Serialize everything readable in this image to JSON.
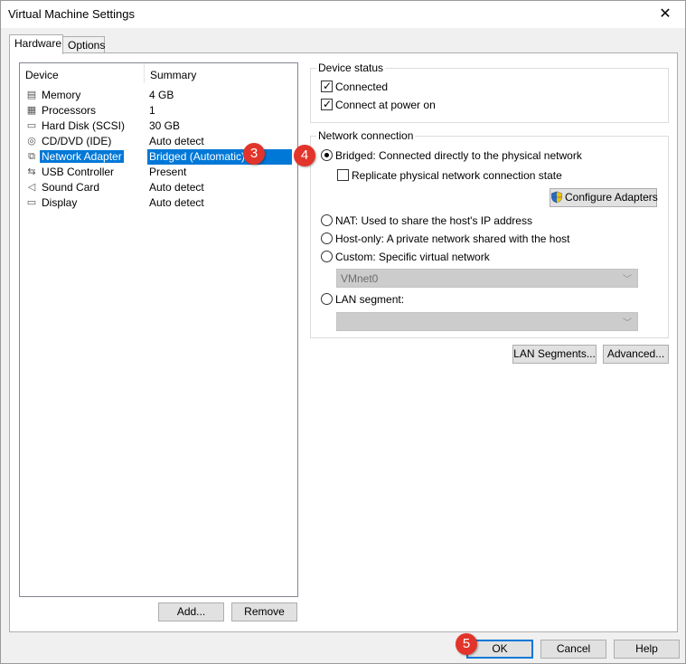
{
  "window": {
    "title": "Virtual Machine Settings",
    "close_glyph": "✕"
  },
  "tabs": [
    {
      "label": "Hardware",
      "active": true
    },
    {
      "label": "Options",
      "active": false
    }
  ],
  "devices": {
    "header": {
      "col1": "Device",
      "col2": "Summary"
    },
    "rows": [
      {
        "name": "Memory",
        "summary": "4 GB",
        "icon": "memory-icon",
        "glyph": "▤"
      },
      {
        "name": "Processors",
        "summary": "1",
        "icon": "processor-icon",
        "glyph": "▦"
      },
      {
        "name": "Hard Disk (SCSI)",
        "summary": "30 GB",
        "icon": "hard-disk-icon",
        "glyph": "▭"
      },
      {
        "name": "CD/DVD (IDE)",
        "summary": "Auto detect",
        "icon": "cd-dvd-icon",
        "glyph": "◎"
      },
      {
        "name": "Network Adapter",
        "summary": "Bridged (Automatic)",
        "icon": "network-adapter-icon",
        "glyph": "⧉",
        "selected": true
      },
      {
        "name": "USB Controller",
        "summary": "Present",
        "icon": "usb-icon",
        "glyph": "⇆"
      },
      {
        "name": "Sound Card",
        "summary": "Auto detect",
        "icon": "speaker-icon",
        "glyph": "◁"
      },
      {
        "name": "Display",
        "summary": "Auto detect",
        "icon": "display-icon",
        "glyph": "▭"
      }
    ],
    "add_label": "Add...",
    "remove_label": "Remove"
  },
  "device_status": {
    "legend": "Device status",
    "connected": {
      "label": "Connected",
      "checked": true
    },
    "connect_power_on": {
      "label": "Connect at power on",
      "checked": true
    }
  },
  "network_connection": {
    "legend": "Network connection",
    "bridged": {
      "label": "Bridged: Connected directly to the physical network",
      "selected": true
    },
    "replicate": {
      "label": "Replicate physical network connection state",
      "checked": false
    },
    "configure_adapters_label": "Configure Adapters",
    "nat": {
      "label": "NAT: Used to share the host's IP address",
      "selected": false
    },
    "host_only": {
      "label": "Host-only: A private network shared with the host",
      "selected": false
    },
    "custom": {
      "label": "Custom: Specific virtual network",
      "selected": false
    },
    "custom_network_value": "VMnet0",
    "lan_segment": {
      "label": "LAN segment:",
      "selected": false
    },
    "lan_segment_value": ""
  },
  "lan_segments_label": "LAN Segments...",
  "advanced_label": "Advanced...",
  "footer": {
    "ok_label": "OK",
    "cancel_label": "Cancel",
    "help_label": "Help"
  },
  "annotations": [
    "3",
    "4",
    "5"
  ],
  "colors": {
    "selection": "#0078d7",
    "annotation_badge": "#e2342a"
  }
}
